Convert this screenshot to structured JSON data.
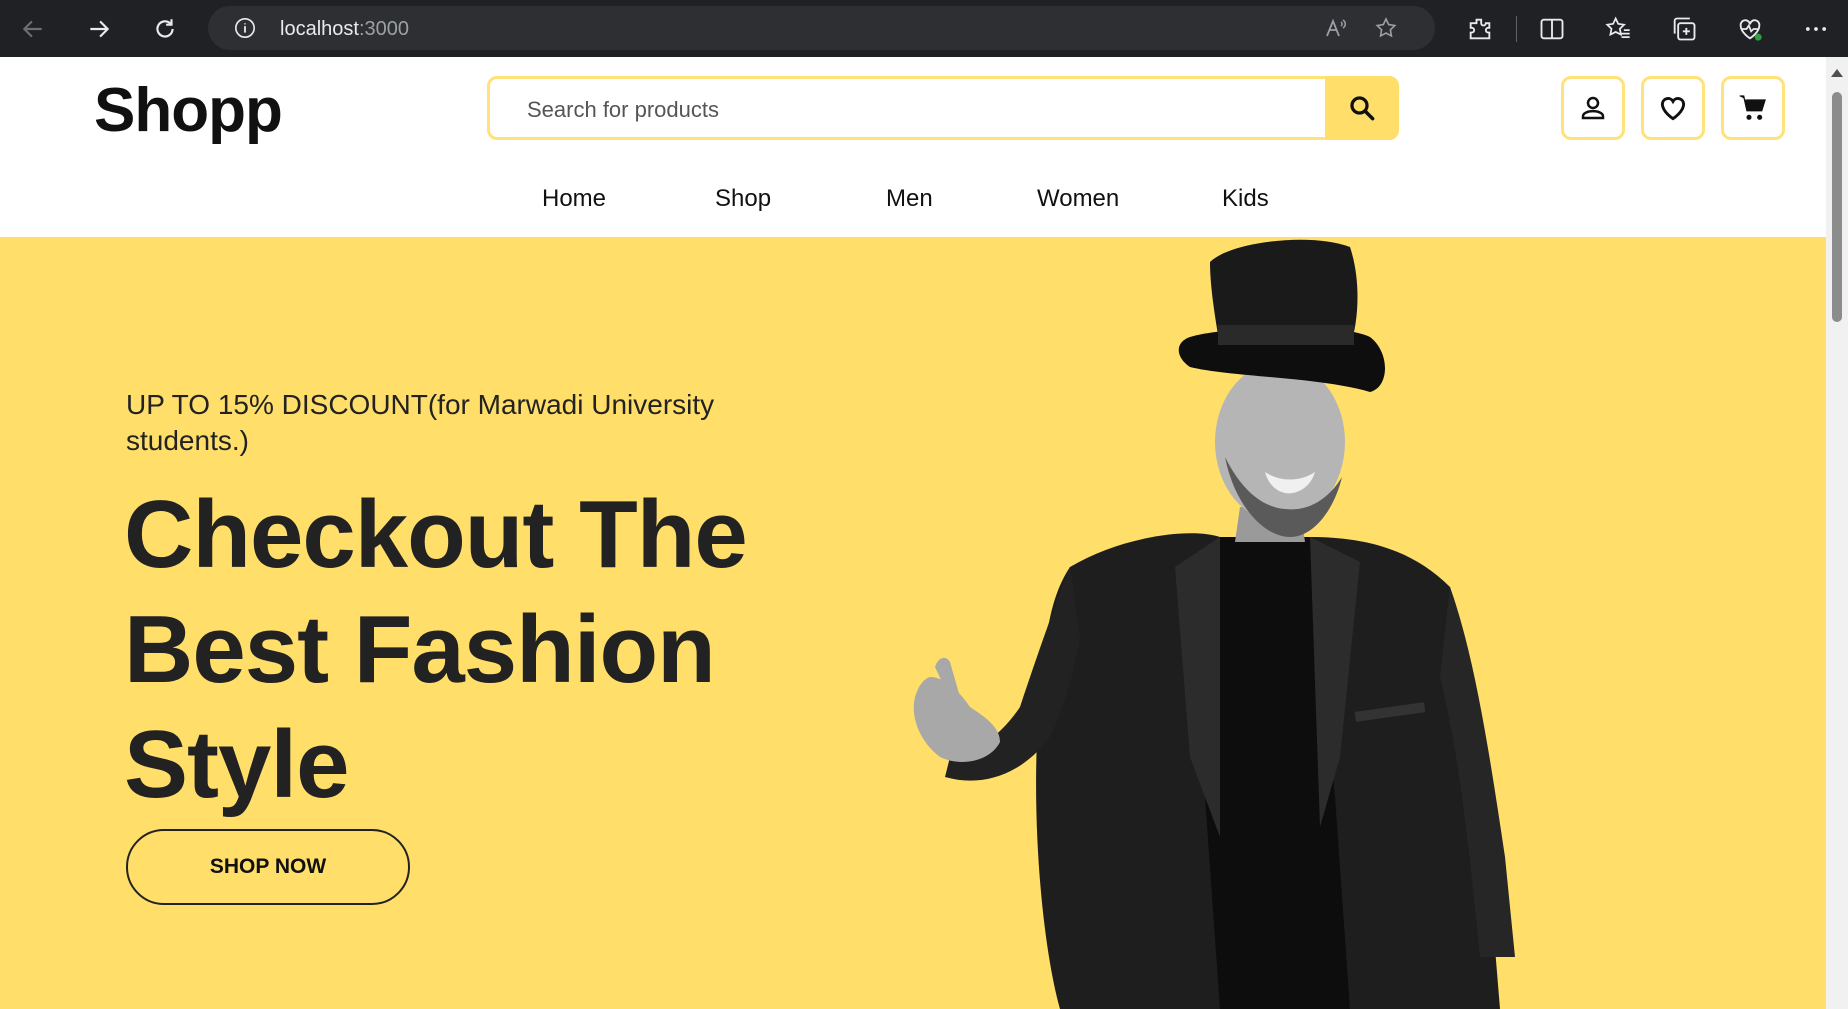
{
  "browser": {
    "url_host": "localhost",
    "url_port": ":3000"
  },
  "site": {
    "logo": "Shopp",
    "search_placeholder": "Search for products",
    "menu": [
      "Home",
      "Shop",
      "Men",
      "Women",
      "Kids"
    ]
  },
  "hero": {
    "promo": "UP TO 15% DISCOUNT(for Marwadi University students.)",
    "headline": "Checkout The Best Fashion Style",
    "cta": "SHOP NOW"
  },
  "colors": {
    "accent": "#ffde6a",
    "text_dark": "#222222",
    "chrome_bg": "#202124"
  }
}
